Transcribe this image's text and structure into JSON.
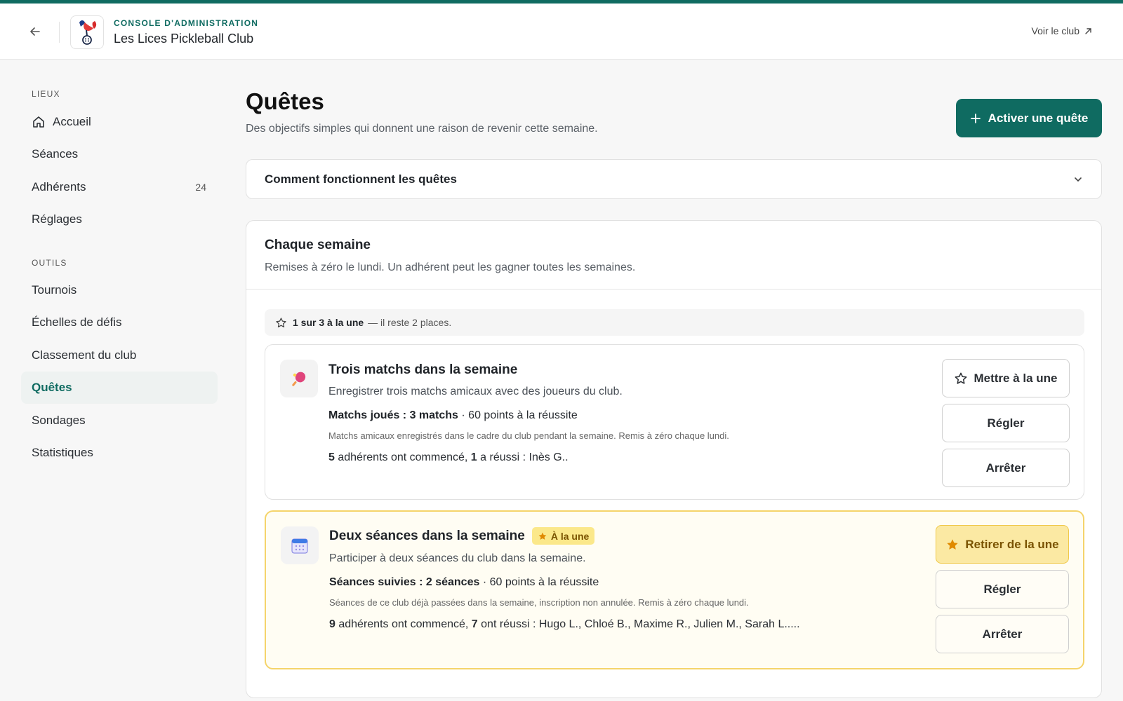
{
  "header": {
    "console_label": "CONSOLE D'ADMINISTRATION",
    "club_name": "Les Lices Pickleball Club",
    "voir_club": "Voir le club"
  },
  "sidebar": {
    "section_lieux": "LIEUX",
    "section_outils": "OUTILS",
    "items": [
      {
        "label": "Accueil"
      },
      {
        "label": "Séances"
      },
      {
        "label": "Adhérents",
        "count": "24"
      },
      {
        "label": "Réglages"
      },
      {
        "label": "Tournois"
      },
      {
        "label": "Échelles de défis"
      },
      {
        "label": "Classement du club"
      },
      {
        "label": "Quêtes",
        "active": true
      },
      {
        "label": "Sondages"
      },
      {
        "label": "Statistiques"
      }
    ]
  },
  "main": {
    "title": "Quêtes",
    "subtitle": "Des objectifs simples qui donnent une raison de revenir cette semaine.",
    "activate_button": "Activer une quête",
    "accordion_label": "Comment fonctionnent les quêtes",
    "weekly": {
      "title": "Chaque semaine",
      "subtitle": "Remises à zéro le lundi. Un adhérent peut les gagner toutes les semaines.",
      "featured_count": "1 sur 3 à la une",
      "featured_rest": "— il reste 2 places."
    },
    "quests": [
      {
        "title": "Trois matchs dans la semaine",
        "description": "Enregistrer trois matchs amicaux avec des joueurs du club.",
        "metric_label": "Matchs joués : 3 matchs",
        "metric_points": " · 60 points à la réussite",
        "note": "Matchs amicaux enregistrés dans le cadre du club pendant la semaine. Remis à zéro chaque lundi.",
        "started_count": "5",
        "started_text": " adhérents ont commencé, ",
        "success_count": "1",
        "success_text": " a réussi : Inès G..",
        "buttons": {
          "feature": "Mettre à la une",
          "settings": "Régler",
          "stop": "Arrêter"
        }
      },
      {
        "title": "Deux séances dans la semaine",
        "badge": "À la une",
        "description": "Participer à deux séances du club dans la semaine.",
        "metric_label": "Séances suivies : 2 séances",
        "metric_points": " · 60 points à la réussite",
        "note": "Séances de ce club déjà passées dans la semaine, inscription non annulée. Remis à zéro chaque lundi.",
        "started_count": "9",
        "started_text": " adhérents ont commencé, ",
        "success_count": "7",
        "success_text": " ont réussi : Hugo L., Chloé B., Maxime R., Julien M., Sarah L.....",
        "buttons": {
          "feature": "Retirer de la une",
          "settings": "Régler",
          "stop": "Arrêter"
        }
      }
    ]
  },
  "colors": {
    "accent": "#0f6b61",
    "featured_bg": "#fffdf3",
    "badge_bg": "#fbe88a",
    "star": "#e08a00"
  }
}
